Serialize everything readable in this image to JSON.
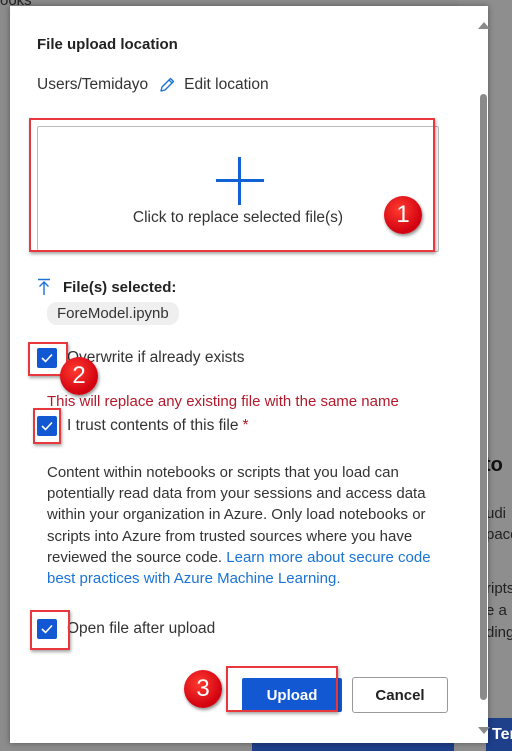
{
  "background": {
    "top_left_text": "ooks",
    "right_heading": "to",
    "right_lines": [
      "udi",
      "pace",
      "ripts",
      "e a r",
      "ding"
    ],
    "right_button": "Ter"
  },
  "dialog": {
    "title": "File upload location",
    "location_path": "Users/Temidayo",
    "edit_location_label": "Edit location",
    "dropzone_label": "Click to replace selected file(s)",
    "files_selected_label": "File(s) selected:",
    "selected_file": "ForeModel.ipynb",
    "overwrite_label": "Overwrite if already exists",
    "overwrite_checked": true,
    "overwrite_warning": "This will replace any existing file with the same name",
    "trust_label": "I trust contents of this file",
    "trust_required_marker": "*",
    "trust_checked": true,
    "trust_description": "Content within notebooks or scripts that you load can potentially read data from your sessions and access data within your organization in Azure. Only load notebooks or scripts into Azure from trusted sources where you have reviewed the source code. ",
    "learn_more_link": "Learn more about secure code best practices with Azure Machine Learning.",
    "open_after_label": "Open file after upload",
    "open_after_checked": true,
    "upload_button": "Upload",
    "cancel_button": "Cancel"
  },
  "callouts": [
    "1",
    "2",
    "3"
  ],
  "colors": {
    "accent": "#1258d3",
    "warning": "#b3192b",
    "link": "#1a73d6",
    "callout": "#e8383d"
  }
}
